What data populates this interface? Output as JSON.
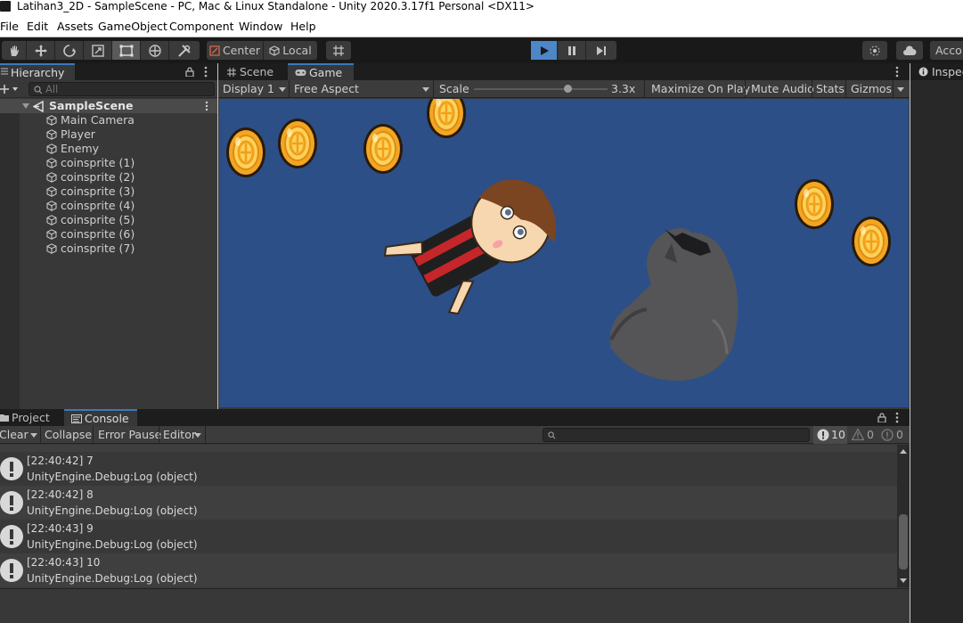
{
  "window": {
    "title": "Latihan3_2D - SampleScene - PC, Mac & Linux Standalone - Unity 2020.3.17f1 Personal <DX11>"
  },
  "menu": [
    "File",
    "Edit",
    "Assets",
    "GameObject",
    "Component",
    "Window",
    "Help"
  ],
  "toolbar": {
    "pivot_label": "Center",
    "space_label": "Local",
    "account_label": "Acco"
  },
  "hierarchy": {
    "tab_label": "Hierarchy",
    "search_placeholder": "All",
    "scene_name": "SampleScene",
    "objects": [
      "Main Camera",
      "Player",
      "Enemy",
      "coinsprite (1)",
      "coinsprite (2)",
      "coinsprite (3)",
      "coinsprite (4)",
      "coinsprite (5)",
      "coinsprite (6)",
      "coinsprite (7)"
    ]
  },
  "game_view": {
    "tabs": [
      "Scene",
      "Game"
    ],
    "display": "Display 1",
    "aspect": "Free Aspect",
    "scale_label": "Scale",
    "scale_value": "3.3x",
    "maximize_label": "Maximize On Play",
    "mute_label": "Mute Audio",
    "stats_label": "Stats",
    "gizmos_label": "Gizmos",
    "background_color": "#2c4f87"
  },
  "inspector": {
    "tab_label": "Inspec"
  },
  "console": {
    "tabs": [
      "Project",
      "Console"
    ],
    "clear_label": "Clear",
    "collapse_label": "Collapse",
    "error_pause_label": "Error Pause",
    "editor_label": "Editor",
    "info_count": "10",
    "warning_count": "0",
    "error_count": "0",
    "logs": [
      {
        "time": "[22:40:42] 7",
        "source": "UnityEngine.Debug:Log (object)"
      },
      {
        "time": "[22:40:42] 8",
        "source": "UnityEngine.Debug:Log (object)"
      },
      {
        "time": "[22:40:43] 9",
        "source": "UnityEngine.Debug:Log (object)"
      },
      {
        "time": "[22:40:43] 10",
        "source": "UnityEngine.Debug:Log (object)"
      }
    ]
  }
}
